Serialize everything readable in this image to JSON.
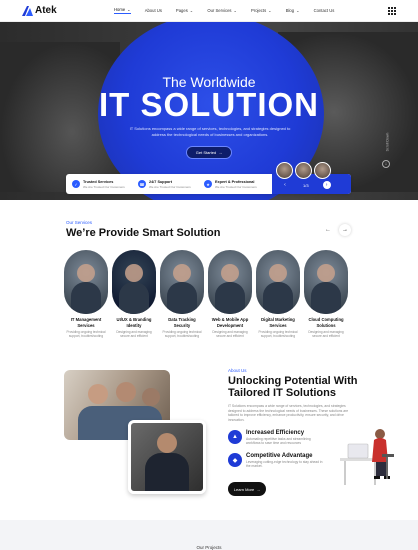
{
  "header": {
    "logo_text": "Atek",
    "nav": [
      "Home",
      "About Us",
      "Pages",
      "Our Services",
      "Projects",
      "Blog",
      "Contact Us"
    ]
  },
  "hero": {
    "subtitle": "The Worldwide",
    "title": "IT SOLUTION",
    "description": "IT Solutions encompass a wide range of services, technologies, and strategies designed to address the technological needs of businesses and organizations.",
    "button_label": "Get Started",
    "scroll_label": "Scroll Down",
    "slide_indicator": "1/3"
  },
  "features": [
    {
      "title": "Trusted Services",
      "sub": "We Are Trusted Our Customers"
    },
    {
      "title": "24/7 Support",
      "sub": "We Are Trusted Our Customers"
    },
    {
      "title": "Expert & Professional",
      "sub": "We Are Trusted Our Customers"
    }
  ],
  "services": {
    "tag": "Our Services",
    "title": "We’re Provide Smart Solution",
    "cards": [
      {
        "title": "IT Management Services",
        "desc": "Providing ongoing technical support, troubleshooting"
      },
      {
        "title": "UI/UX & Branding Identity",
        "desc": "Designing and managing secure and efficient"
      },
      {
        "title": "Data Tracking Security",
        "desc": "Providing ongoing technical support, troubleshooting"
      },
      {
        "title": "Web & Mobile App Development",
        "desc": "Designing and managing secure and efficient"
      },
      {
        "title": "Digital Marketing Services",
        "desc": "Providing ongoing technical support, troubleshooting"
      },
      {
        "title": "Cloud Computing Solutions",
        "desc": "Designing and managing secure and efficient"
      }
    ]
  },
  "about": {
    "tag": "About Us",
    "title": "Unlocking Potential With Tailored IT Solutions",
    "description": "IT Solutions encompass a wide range of services, technologies, and strategies designed to address the technological needs of businesses. These solutions are tailored to improve efficiency, enhance productivity, ensure security, and drive innovation.",
    "items": [
      {
        "title": "Increased Efficiency",
        "desc": "Automating repetitive tasks and streamlining workflows to save time and resources"
      },
      {
        "title": "Competitive Advantage",
        "desc": "Leveraging cutting-edge technology to stay ahead in the market."
      }
    ],
    "button_label": "Learn More"
  },
  "projects": {
    "tag": "Our Projects"
  },
  "colors": {
    "accent": "#1f3bd6",
    "brand_blue": "#2b5cff"
  }
}
